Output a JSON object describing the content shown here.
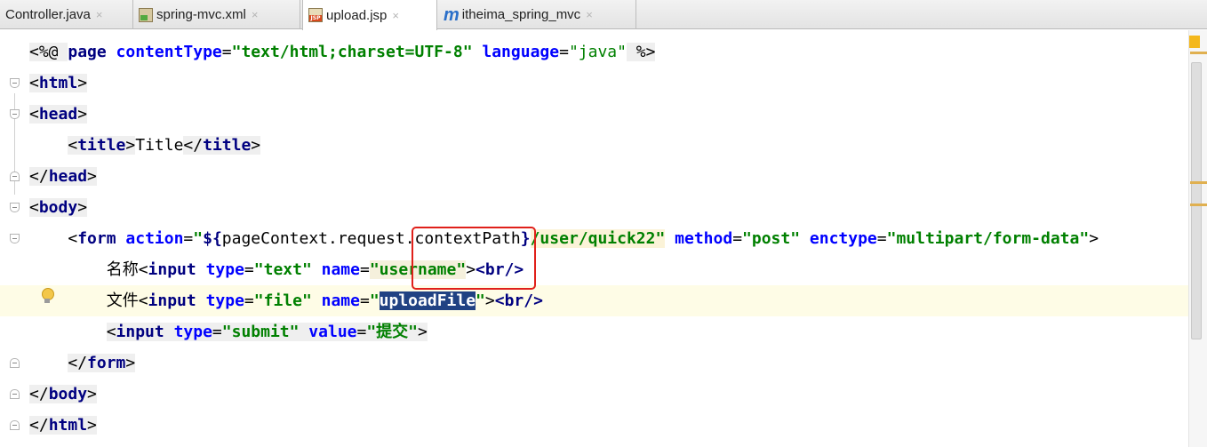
{
  "tabs": [
    {
      "label": "Controller.java",
      "icon": "java-class-icon",
      "active": false
    },
    {
      "label": "spring-mvc.xml",
      "icon": "xml-file-icon",
      "active": false
    },
    {
      "label": "upload.jsp",
      "icon": "jsp-file-icon",
      "active": true
    },
    {
      "label": "itheima_spring_mvc",
      "icon": "maven-module-icon",
      "active": false
    }
  ],
  "close_glyph": "×",
  "code": {
    "l1": {
      "open": "<%@ ",
      "kw1": "page ",
      "a1": "contentType",
      "eq1": "=",
      "s1": "\"text/html;charset=UTF-8\"",
      "a2": " language",
      "eq2": "=",
      "s2": "\"java\"",
      "end": " %>"
    },
    "l2": {
      "lt": "<",
      "tag": "html",
      "gt": ">"
    },
    "l3": {
      "lt": "<",
      "tag": "head",
      "gt": ">"
    },
    "l4": {
      "indent": "    ",
      "lt": "<",
      "tag": "title",
      "gt": ">",
      "text": "Title",
      "clt": "</",
      "ctag": "title",
      "cgt": ">"
    },
    "l5": {
      "lt": "</",
      "tag": "head",
      "gt": ">"
    },
    "l6": {
      "lt": "<",
      "tag": "body",
      "gt": ">"
    },
    "l7": {
      "indent": "    ",
      "lt": "<",
      "tag": "form",
      "a1": " action",
      "eq1": "=",
      "q1": "\"",
      "el_open": "${",
      "el_expr": "pageContext.request.contextPath",
      "el_close": "}",
      "path": "/user/quick22",
      "q1c": "\"",
      "a2": " method",
      "eq2": "=",
      "s2": "\"post\"",
      "a3": " enctype",
      "eq3": "=",
      "s3": "\"multipart/form-data\"",
      "gt": ">"
    },
    "l8": {
      "indent": "        ",
      "label": "名称",
      "lt": "<",
      "tag": "input",
      "a1": " type",
      "eq1": "=",
      "s1": "\"text\"",
      "a2": " name",
      "eq2": "=",
      "s2": "\"username\"",
      "gt": ">",
      "br": "<br/>"
    },
    "l9": {
      "indent": "        ",
      "label": "文件",
      "lt": "<",
      "tag": "input",
      "a1": " type",
      "eq1": "=",
      "s1": "\"file\"",
      "a2": " name",
      "eq2": "=",
      "q2": "\"",
      "sel": "uploadFile",
      "q2c": "\"",
      "gt": ">",
      "br": "<br/>"
    },
    "l10": {
      "indent": "        ",
      "lt": "<",
      "tag": "input",
      "a1": " type",
      "eq1": "=",
      "s1": "\"submit\"",
      "a2": " value",
      "eq2": "=",
      "s2": "\"提交\"",
      "gt": ">"
    },
    "l11": {
      "indent": "    ",
      "lt": "</",
      "tag": "form",
      "gt": ">"
    },
    "l12": {
      "lt": "</",
      "tag": "body",
      "gt": ">"
    },
    "l13": {
      "lt": "</",
      "tag": "html",
      "gt": ">"
    }
  },
  "colors": {
    "tag": "#000080",
    "attr": "#0000ff",
    "string": "#008000",
    "selection": "#214283",
    "highlight_box": "#e0201a",
    "current_line": "#fefce6"
  }
}
